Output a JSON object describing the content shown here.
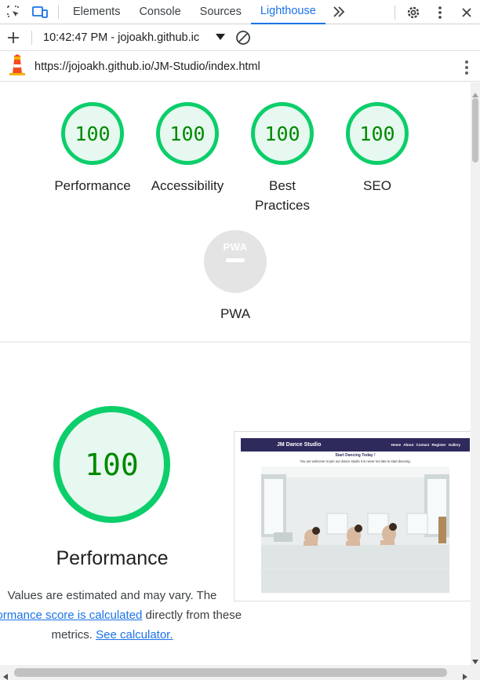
{
  "devtools": {
    "tabs": [
      "Elements",
      "Console",
      "Sources",
      "Lighthouse"
    ],
    "active_tab": "Lighthouse",
    "more_tabs_label": ">>"
  },
  "toolbar": {
    "report_label": "10:42:47 PM - jojoakh.github.ic"
  },
  "urlbar": {
    "url": "https://jojoakh.github.io/JM-Studio/index.html"
  },
  "scores": [
    {
      "label": "Performance",
      "value": "100"
    },
    {
      "label": "Accessibility",
      "value": "100"
    },
    {
      "label": "Best Practices",
      "value": "100"
    },
    {
      "label": "SEO",
      "value": "100"
    }
  ],
  "pwa": {
    "logo": "PWA",
    "label": "PWA"
  },
  "performance": {
    "score": "100",
    "title": "Performance",
    "desc_1": "Values are estimated and may vary. The ",
    "desc_link": "erformance score is calculated",
    "desc_2": " directly from these metrics. ",
    "calc_link": "See calculator."
  },
  "screenshot": {
    "brand": "JM Dance Studio",
    "links": "Home About Contact Register Gallery",
    "heading": "Start Dancing Today !",
    "text": "You are welcome to join our dance studio it is never too late to start dancing."
  },
  "colors": {
    "pass": "#0cce6b",
    "pass_text": "#008800",
    "pass_bg": "#e6f8ef",
    "accent": "#1a73e8",
    "nav": "#2e2a5c"
  }
}
